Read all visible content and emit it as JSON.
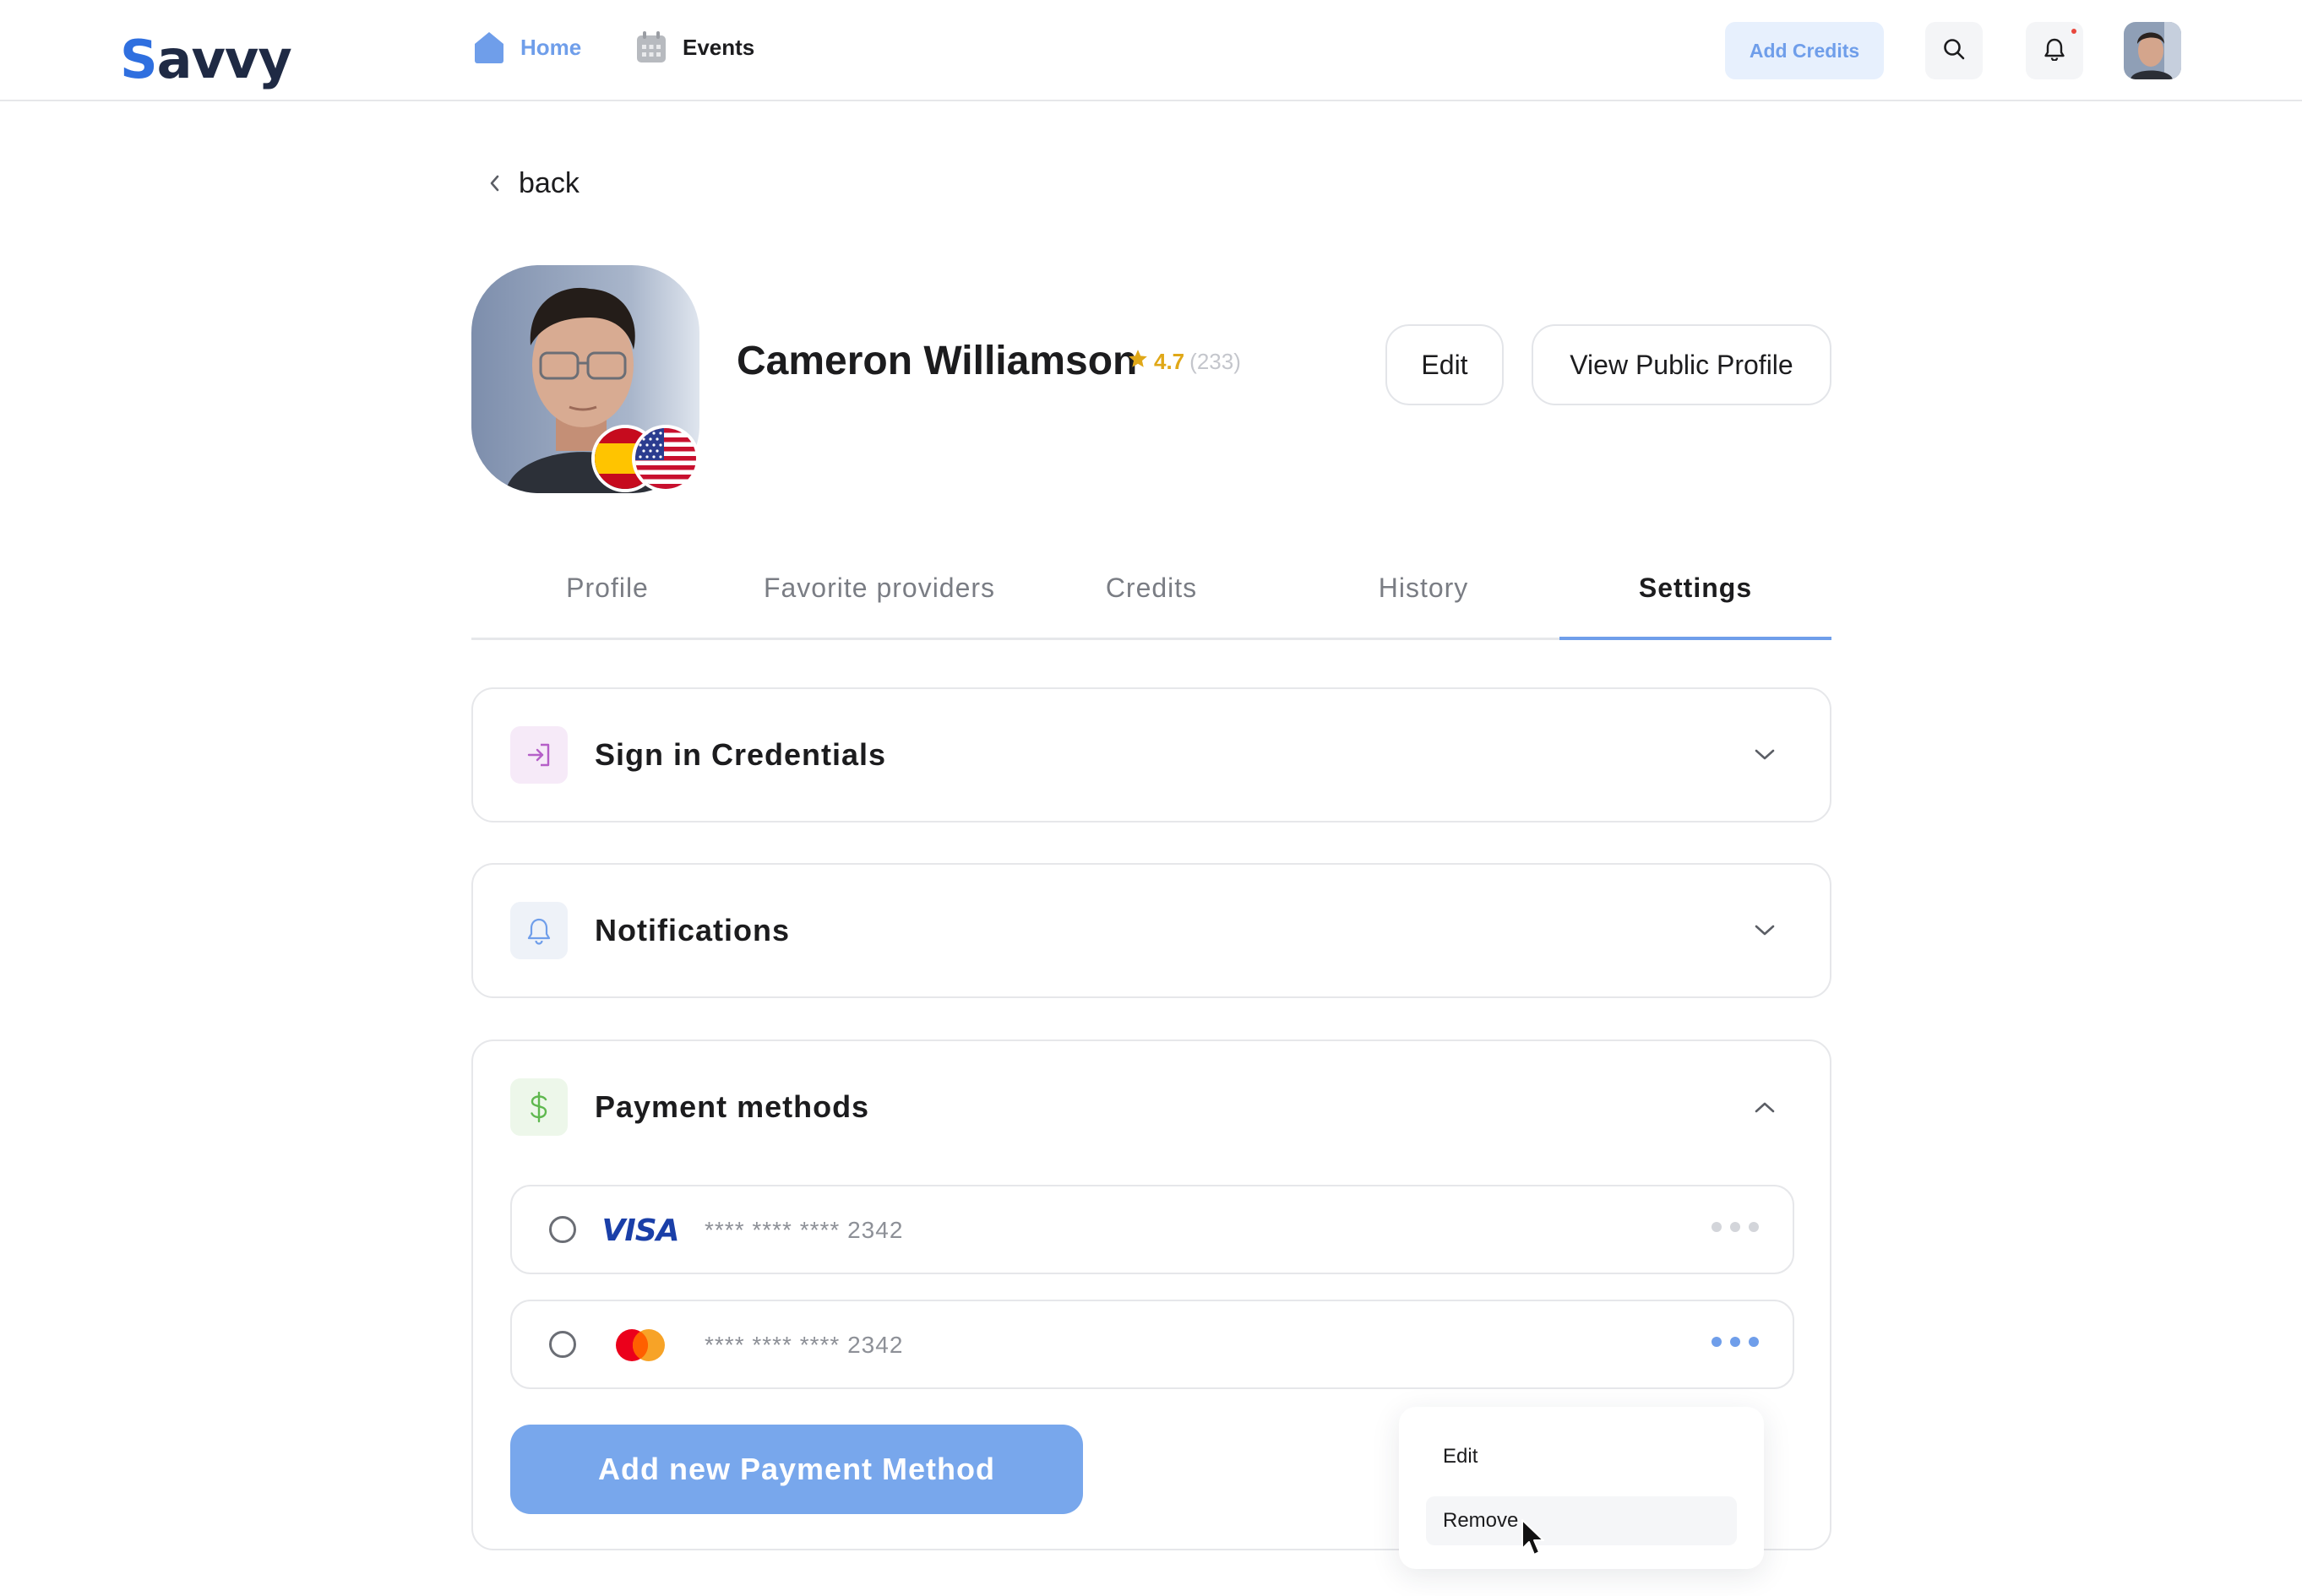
{
  "brand": {
    "logo_first": "S",
    "logo_rest": "avvy"
  },
  "nav": {
    "home_label": "Home",
    "events_label": "Events",
    "add_credits_label": "Add Credits"
  },
  "back_label": "back",
  "profile": {
    "name": "Cameron Williamson",
    "rating": "4.7",
    "rating_count": "(233)",
    "edit_label": "Edit",
    "view_public_label": "View Public Profile"
  },
  "tabs": [
    {
      "label": "Profile"
    },
    {
      "label": "Favorite providers"
    },
    {
      "label": "Credits"
    },
    {
      "label": "History"
    },
    {
      "label": "Settings"
    }
  ],
  "active_tab": "Settings",
  "sections": {
    "credentials_title": "Sign in Credentials",
    "notifications_title": "Notifications",
    "payment_title": "Payment methods"
  },
  "payment_methods": [
    {
      "brand": "VISA",
      "masked_number": "**** **** **** 2342"
    },
    {
      "brand": "mastercard",
      "masked_number": "**** **** **** 2342"
    }
  ],
  "add_payment_label": "Add new Payment Method",
  "context_menu": {
    "edit_label": "Edit",
    "remove_label": "Remove"
  },
  "colors": {
    "accent": "#6f9eea",
    "button_primary": "#78a7ec",
    "rating_star": "#e0a818",
    "credentials_icon_bg": "#f6eaf8",
    "notifications_icon_bg": "#eef2f8",
    "payment_icon_bg": "#edf7ea"
  }
}
